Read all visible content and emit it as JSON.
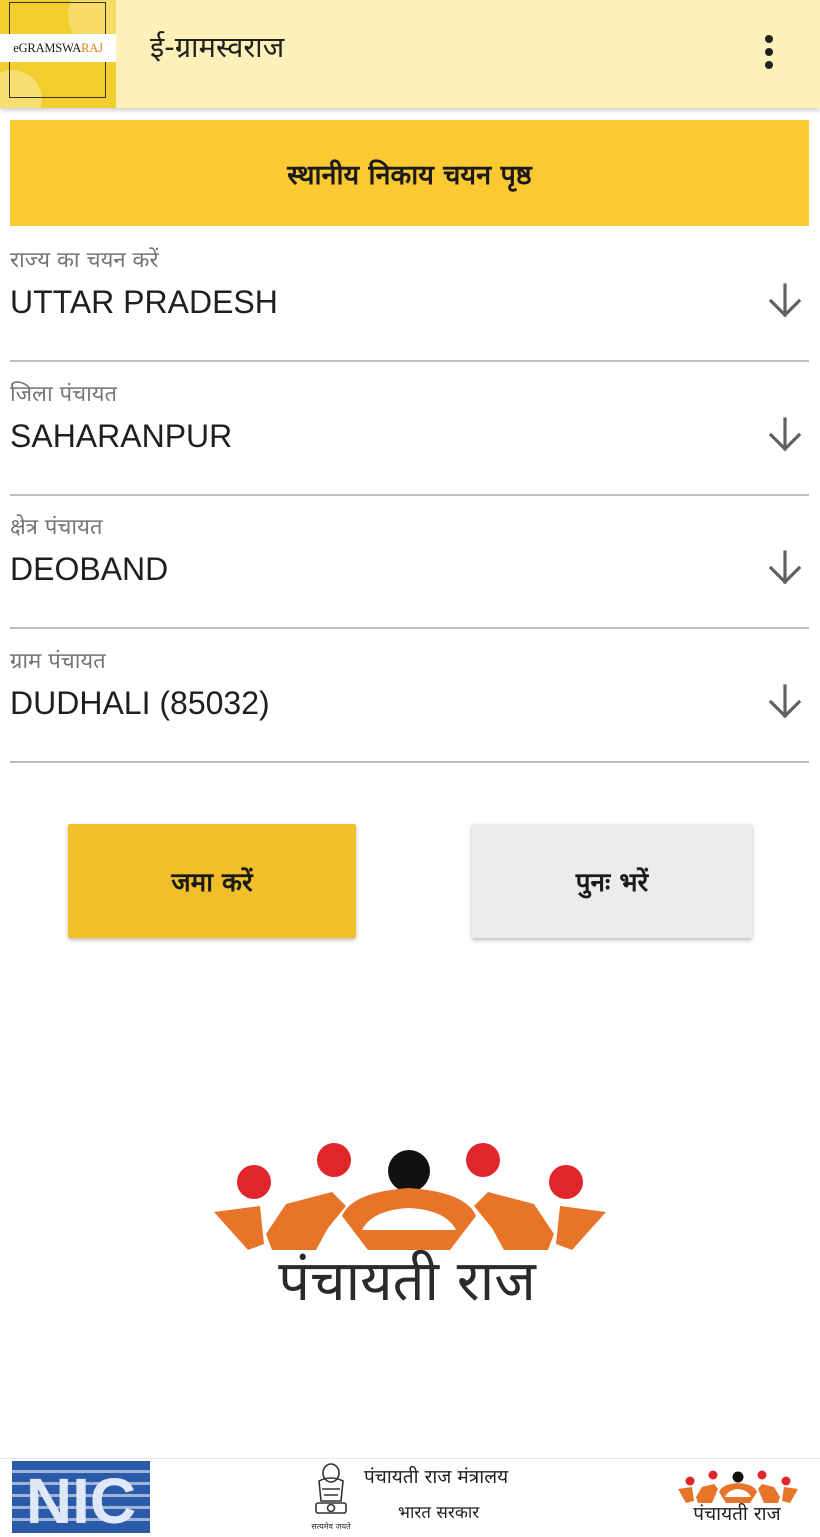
{
  "app_bar": {
    "logo_text_main": "eGRAMSWA",
    "logo_text_accent": "RAJ",
    "title": "ई-ग्रामस्वराज",
    "menu_icon": "more-vert-icon"
  },
  "page_header": {
    "title": "स्थानीय निकाय चयन पृष्ठ"
  },
  "fields": [
    {
      "label": "राज्य का चयन करें",
      "value": "UTTAR PRADESH",
      "icon": "arrow-down-icon"
    },
    {
      "label": "जिला पंचायत",
      "value": "SAHARANPUR",
      "icon": "arrow-down-icon"
    },
    {
      "label": "क्षेत्र पंचायत",
      "value": "DEOBAND",
      "icon": "arrow-down-icon"
    },
    {
      "label": "ग्राम पंचायत",
      "value": "DUDHALI (85032)",
      "icon": "arrow-down-icon"
    }
  ],
  "buttons": {
    "submit_label": "जमा करें",
    "reset_label": "पुनः भरें"
  },
  "logo": {
    "caption": "पंचायती राज"
  },
  "footer": {
    "nic_logo_text": "NIC",
    "ministry_name": "पंचायती राज मंत्रालय",
    "ministry_sub": "भारत सरकार",
    "emblem_motto": "सत्यमेव जयते",
    "right_logo_caption": "पंचायती राज"
  },
  "colors": {
    "app_bar_bg": "#fdf0b8",
    "banner_bg": "#fdc933",
    "submit_bg": "#f0bf2a",
    "reset_bg": "#ececec",
    "logo_orange": "#e8742a",
    "logo_red": "#e0262b",
    "nic_blue": "#2a5aa8"
  }
}
